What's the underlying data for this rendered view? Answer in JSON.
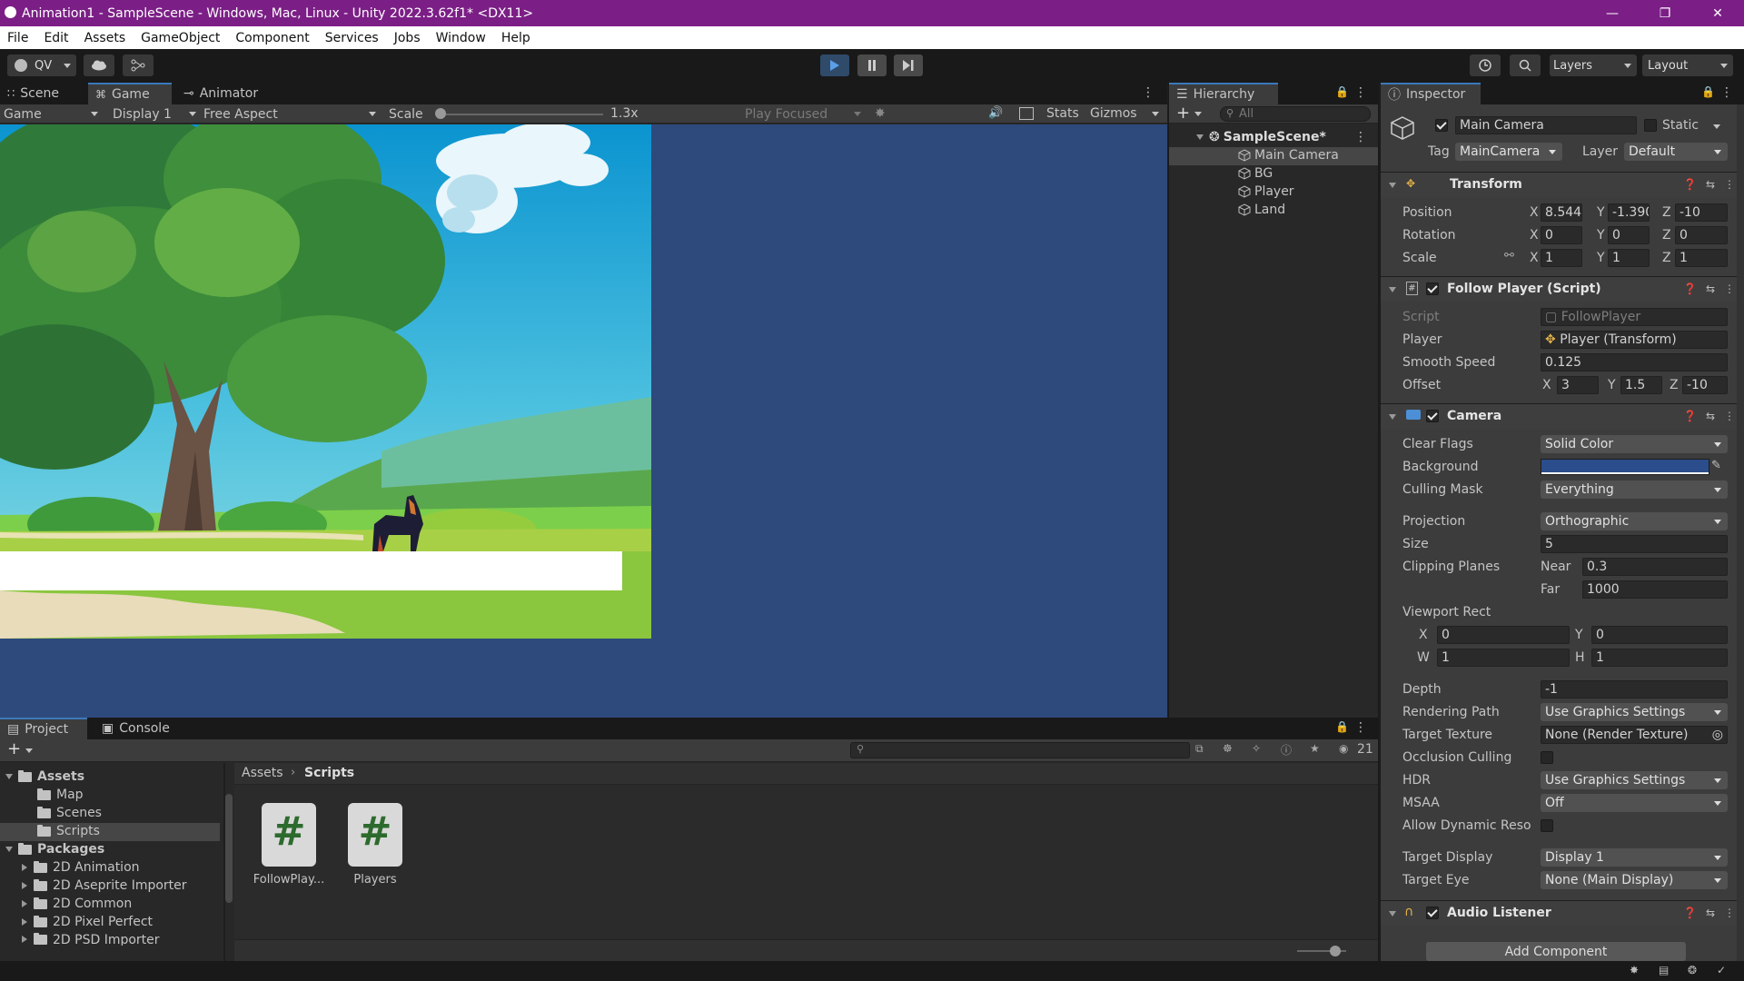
{
  "window": {
    "title": "Animation1 - SampleScene - Windows, Mac, Linux - Unity 2022.3.62f1* <DX11>",
    "controls": {
      "minimize": "—",
      "maximize": "❐",
      "close": "✕"
    }
  },
  "menu": [
    "File",
    "Edit",
    "Assets",
    "GameObject",
    "Component",
    "Services",
    "Jobs",
    "Window",
    "Help"
  ],
  "toolbar": {
    "account_label": "QV",
    "layers_label": "Layers",
    "layout_label": "Layout",
    "play_state": "playing"
  },
  "scene_panel": {
    "tabs": [
      "Scene",
      "Game",
      "Animator"
    ],
    "active_tab": "Game",
    "game_view": {
      "mode": "Game",
      "display": "Display 1",
      "aspect": "Free Aspect",
      "scale_label": "Scale",
      "scale_value": "1.3x",
      "play_focus": "Play Focused",
      "stats": "Stats",
      "gizmos": "Gizmos"
    },
    "background_color": "#2e4a7c"
  },
  "hierarchy": {
    "tab": "Hierarchy",
    "search_placeholder": "All",
    "scene": "SampleScene*",
    "objects": [
      "Main Camera",
      "BG",
      "Player",
      "Land"
    ],
    "selected": "Main Camera"
  },
  "inspector": {
    "tab": "Inspector",
    "object_name": "Main Camera",
    "static_label": "Static",
    "tag_label": "Tag",
    "tag_value": "MainCamera",
    "layer_label": "Layer",
    "layer_value": "Default",
    "transform": {
      "title": "Transform",
      "position": {
        "label": "Position",
        "x": "8.544",
        "y": "-1.390",
        "z": "-10"
      },
      "rotation": {
        "label": "Rotation",
        "x": "0",
        "y": "0",
        "z": "0"
      },
      "scale": {
        "label": "Scale",
        "x": "1",
        "y": "1",
        "z": "1"
      }
    },
    "follow_player": {
      "title": "Follow Player (Script)",
      "script_label": "Script",
      "script_value": "FollowPlayer",
      "player_label": "Player",
      "player_value": "Player (Transform)",
      "smooth_label": "Smooth Speed",
      "smooth_value": "0.125",
      "offset_label": "Offset",
      "offset": {
        "x": "3",
        "y": "1.5",
        "z": "-10"
      }
    },
    "camera": {
      "title": "Camera",
      "clear_flags_label": "Clear Flags",
      "clear_flags": "Solid Color",
      "background_label": "Background",
      "background_color": "#2c4d8c",
      "culling_label": "Culling Mask",
      "culling": "Everything",
      "projection_label": "Projection",
      "projection": "Orthographic",
      "size_label": "Size",
      "size": "5",
      "clipping_label": "Clipping Planes",
      "near_label": "Near",
      "near": "0.3",
      "far_label": "Far",
      "far": "1000",
      "viewport_label": "Viewport Rect",
      "vp": {
        "x": "0",
        "y": "0",
        "w": "1",
        "h": "1"
      },
      "depth_label": "Depth",
      "depth": "-1",
      "rendering_label": "Rendering Path",
      "rendering": "Use Graphics Settings",
      "target_texture_label": "Target Texture",
      "target_texture": "None (Render Texture)",
      "occlusion_label": "Occlusion Culling",
      "hdr_label": "HDR",
      "hdr": "Use Graphics Settings",
      "msaa_label": "MSAA",
      "msaa": "Off",
      "dynres_label": "Allow Dynamic Reso",
      "target_display_label": "Target Display",
      "target_display": "Display 1",
      "target_eye_label": "Target Eye",
      "target_eye": "None (Main Display)"
    },
    "audio_listener": {
      "title": "Audio Listener"
    },
    "add_component": "Add Component"
  },
  "project": {
    "tabs": [
      "Project",
      "Console"
    ],
    "breadcrumb": [
      "Assets",
      "Scripts"
    ],
    "hidden_count": "21",
    "tree": {
      "assets": "Assets",
      "asset_folders": [
        "Map",
        "Scenes",
        "Scripts"
      ],
      "packages": "Packages",
      "package_folders": [
        "2D Animation",
        "2D Aseprite Importer",
        "2D Common",
        "2D Pixel Perfect",
        "2D PSD Importer"
      ]
    },
    "files": [
      {
        "name": "FollowPlay...",
        "glyph": "#"
      },
      {
        "name": "Players",
        "glyph": "#"
      }
    ]
  },
  "colors": {
    "titlebar": "#7b1f86",
    "accent": "#3a79bb",
    "panel": "#282828"
  }
}
